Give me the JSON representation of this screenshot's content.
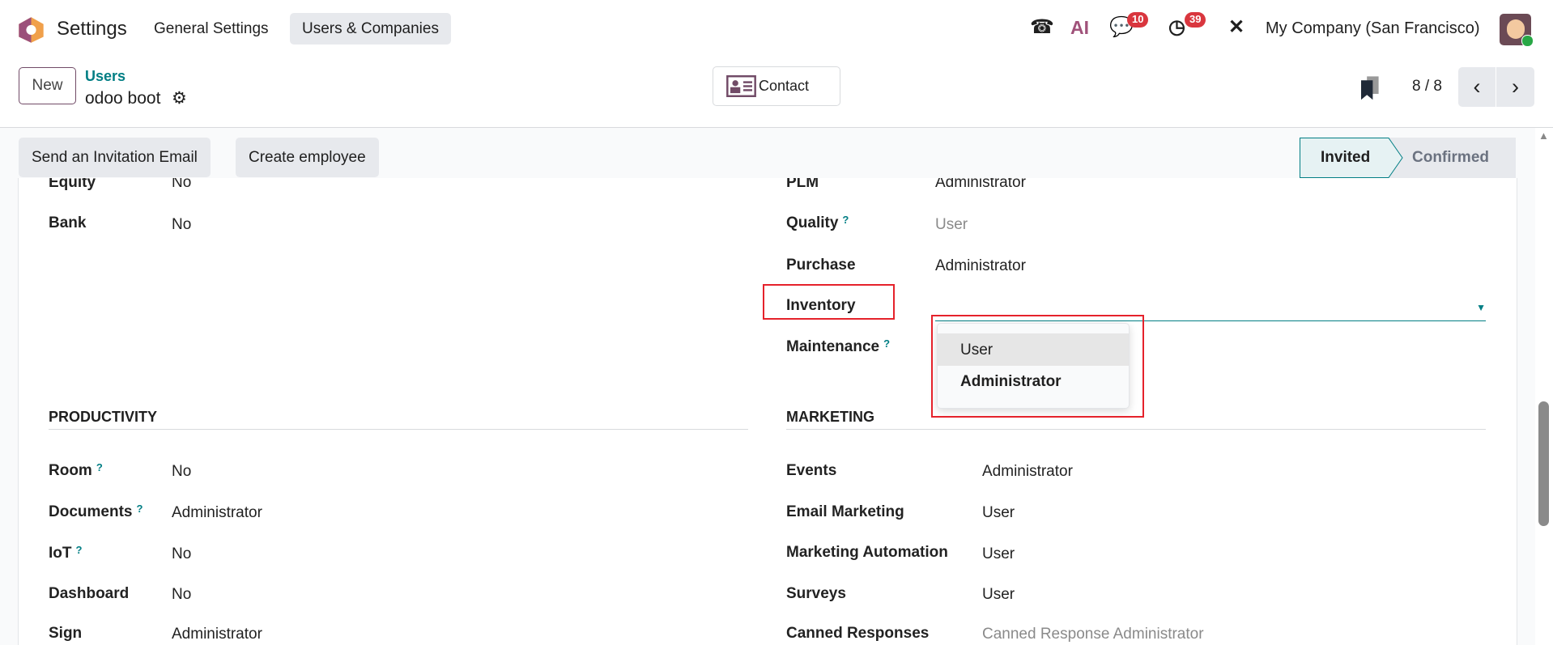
{
  "navbar": {
    "app_name": "Settings",
    "menu": [
      "General Settings",
      "Users & Companies"
    ],
    "messages_count": "10",
    "activities_count": "39",
    "company": "My Company (San Francisco)",
    "ai_label": "AI"
  },
  "control_panel": {
    "new_label": "New",
    "breadcrumb_parent": "Users",
    "record_name": "odoo boot",
    "contact_label": "Contact",
    "pager": "8 / 8"
  },
  "statusbar": {
    "buttons": [
      "Send an Invitation Email",
      "Create employee"
    ],
    "stages": [
      "Invited",
      "Confirmed"
    ],
    "current_stage": "Invited"
  },
  "form": {
    "left_top": [
      {
        "label": "Equity",
        "value": "No"
      },
      {
        "label": "Bank",
        "value": "No"
      }
    ],
    "right_top": [
      {
        "label": "PLM",
        "value": "Administrator"
      },
      {
        "label": "Quality",
        "value": "User",
        "help": "?"
      },
      {
        "label": "Purchase",
        "value": "Administrator"
      },
      {
        "label": "Inventory",
        "value": ""
      },
      {
        "label": "Maintenance",
        "value": "",
        "help": "?"
      }
    ],
    "inventory_options": [
      "User",
      "Administrator"
    ],
    "productivity": {
      "title": "PRODUCTIVITY",
      "rows": [
        {
          "label": "Room",
          "value": "No",
          "help": "?"
        },
        {
          "label": "Documents",
          "value": "Administrator",
          "help": "?"
        },
        {
          "label": "IoT",
          "value": "No",
          "help": "?"
        },
        {
          "label": "Dashboard",
          "value": "No"
        },
        {
          "label": "Sign",
          "value": "Administrator"
        }
      ]
    },
    "marketing": {
      "title": "MARKETING",
      "rows": [
        {
          "label": "Events",
          "value": "Administrator"
        },
        {
          "label": "Email Marketing",
          "value": "User"
        },
        {
          "label": "Marketing Automation",
          "value": "User"
        },
        {
          "label": "Surveys",
          "value": "User"
        },
        {
          "label": "Canned Responses",
          "value": "Canned Response Administrator"
        }
      ]
    }
  },
  "colors": {
    "brand": "#714b67",
    "accent": "#017e84",
    "highlight": "#e5222b"
  }
}
